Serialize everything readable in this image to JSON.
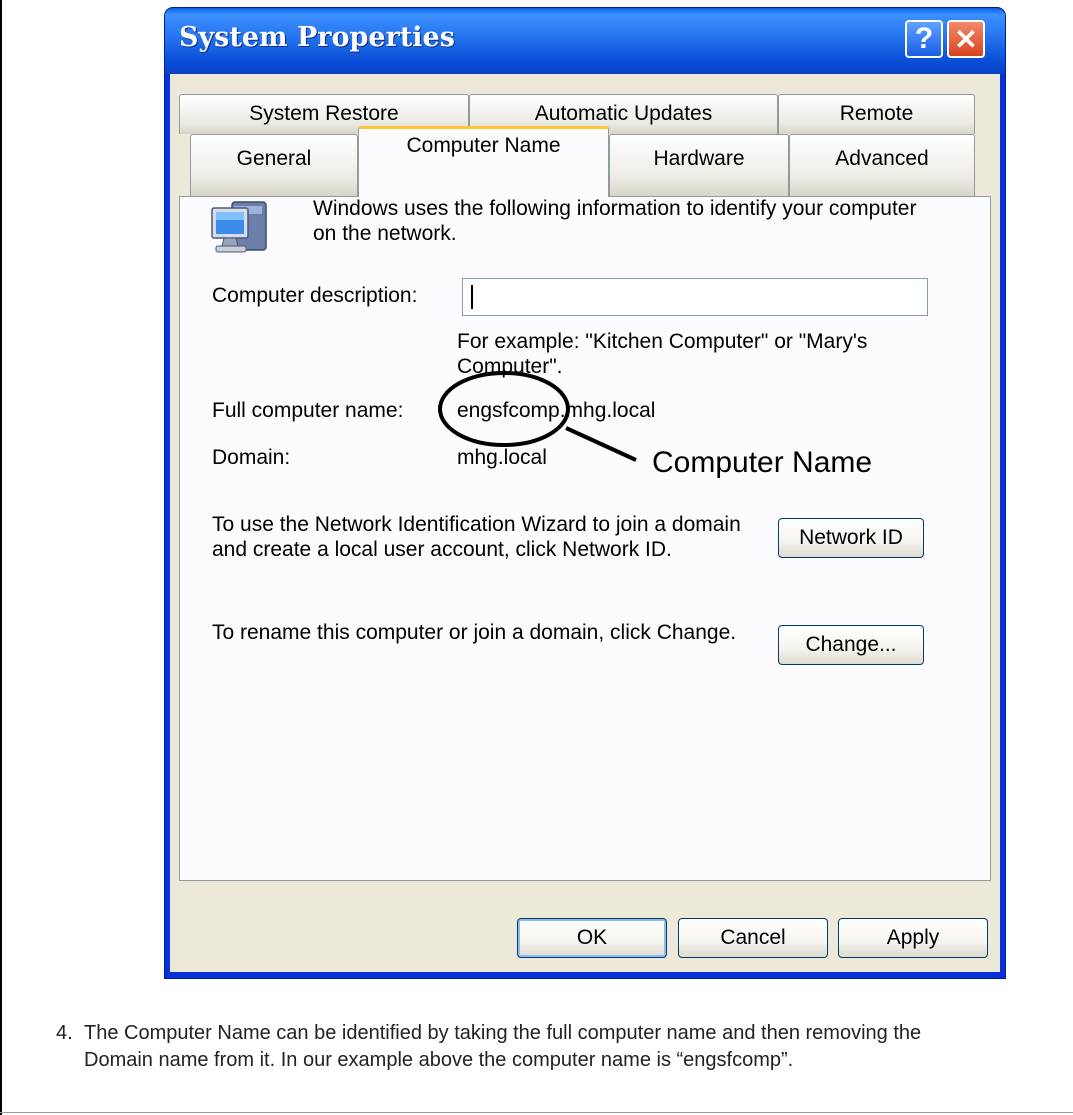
{
  "window": {
    "title": "System Properties",
    "help_label": "?",
    "close_label": "✕"
  },
  "tabs": {
    "row1": [
      "System Restore",
      "Automatic Updates",
      "Remote"
    ],
    "row2": [
      "General",
      "Computer Name",
      "Hardware",
      "Advanced"
    ],
    "active": "Computer Name"
  },
  "panel": {
    "intro": "Windows uses the following information to identify your computer on the network.",
    "description_label": "Computer description:",
    "description_value": "",
    "example": "For example: \"Kitchen Computer\" or \"Mary's Computer\".",
    "full_name_label": "Full computer name:",
    "full_name_value": "engsfcomp.mhg.local",
    "domain_label": "Domain:",
    "domain_value": "mhg.local",
    "network_id_text": "To use the Network Identification Wizard to join a domain and create a local user account, click Network ID.",
    "network_id_button": "Network ID",
    "change_text": "To rename this computer or join a domain, click Change.",
    "change_button": "Change..."
  },
  "buttons": {
    "ok": "OK",
    "cancel": "Cancel",
    "apply": "Apply"
  },
  "annotation": {
    "label": "Computer Name"
  },
  "footer": {
    "number": "4.",
    "text": "The Computer Name can be identified by taking the full computer name and then removing the Domain name from it. In our example above the computer name is “engsfcomp”."
  },
  "icons": {
    "computer": "computer-monitor-icon"
  }
}
